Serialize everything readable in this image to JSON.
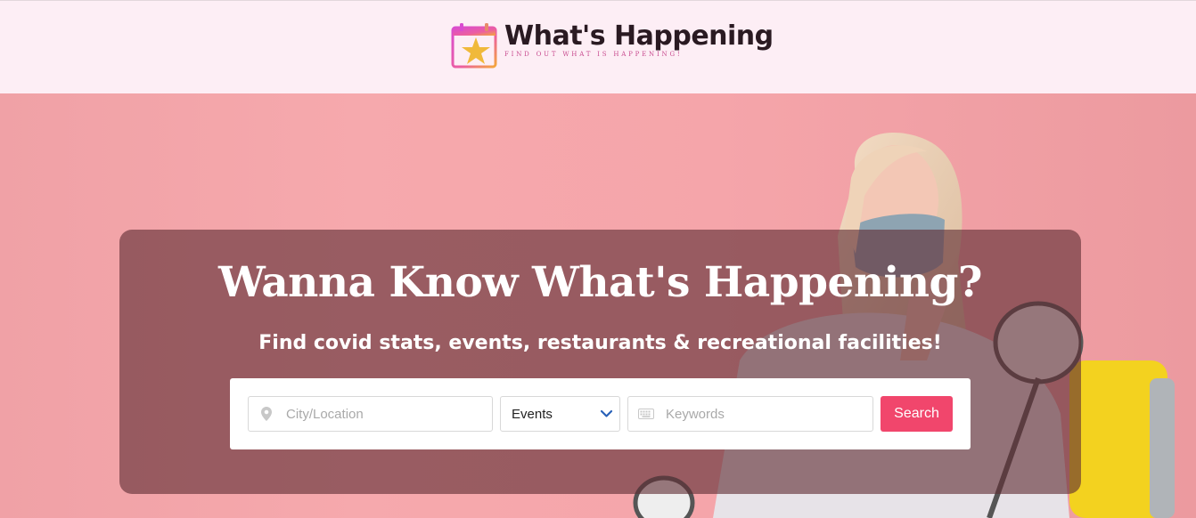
{
  "header": {
    "brand_name": "What's Happening",
    "brand_tagline": "FIND OUT WHAT IS HAPPENING!",
    "logo_icon": "calendar-star-icon"
  },
  "hero": {
    "headline": "Wanna Know What's Happening?",
    "subheadline": "Find covid stats, events, restaurants & recreational facilities!",
    "background_image": "woman-with-mask-and-yellow-suitcase"
  },
  "search": {
    "location_placeholder": "City/Location",
    "location_icon": "map-pin-icon",
    "type_selected": "Events",
    "keywords_placeholder": "Keywords",
    "keywords_icon": "keyboard-icon",
    "submit_label": "Search"
  },
  "colors": {
    "header_bg": "#fdeef5",
    "hero_bg": "#f5a5aa",
    "overlay": "rgba(95,45,52,0.62)",
    "button": "#f1466c",
    "chevron": "#2a62b8"
  }
}
